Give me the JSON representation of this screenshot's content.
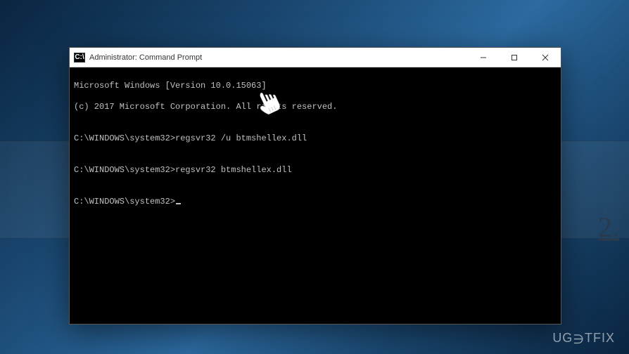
{
  "window": {
    "title": "Administrator: Command Prompt"
  },
  "terminal": {
    "line1": "Microsoft Windows [Version 10.0.15063]",
    "line2": "(c) 2017 Microsoft Corporation. All rights reserved.",
    "blank1": "",
    "line3": "C:\\WINDOWS\\system32>regsvr32 /u btmshellex.dll",
    "blank2": "",
    "line4": "C:\\WINDOWS\\system32>regsvr32 btmshellex.dll",
    "blank3": "",
    "prompt": "C:\\WINDOWS\\system32>"
  },
  "watermark": {
    "text_prefix": "UG",
    "text_mid": "∋",
    "text_suffix": "TFIX"
  },
  "side_marker": {
    "text": "2."
  }
}
